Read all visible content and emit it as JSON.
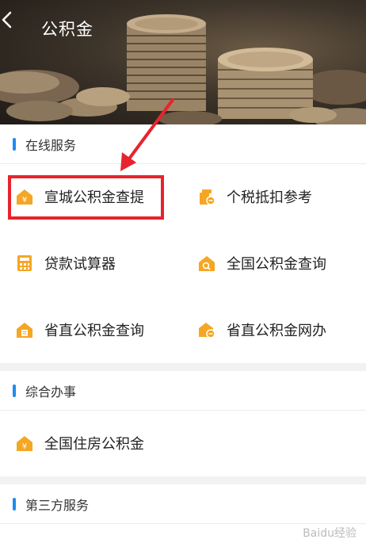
{
  "header": {
    "title": "公积金"
  },
  "sections": [
    {
      "title": "在线服务",
      "items": [
        {
          "label": "宣城公积金查提",
          "icon": "yuan-house-icon"
        },
        {
          "label": "个税抵扣参考",
          "icon": "tax-stack-icon"
        },
        {
          "label": "贷款试算器",
          "icon": "calculator-icon"
        },
        {
          "label": "全国公积金查询",
          "icon": "house-search-icon"
        },
        {
          "label": "省直公积金查询",
          "icon": "house-document-icon"
        },
        {
          "label": "省直公积金网办",
          "icon": "house-minus-icon"
        }
      ]
    },
    {
      "title": "综合办事",
      "items": [
        {
          "label": "全国住房公积金",
          "icon": "yuan-house-icon"
        }
      ]
    },
    {
      "title": "第三方服务",
      "items": []
    }
  ],
  "watermark": "Baidu经验",
  "colors": {
    "accent": "#1e8cf0",
    "icon": "#f5a623",
    "highlight": "#e8232d"
  }
}
